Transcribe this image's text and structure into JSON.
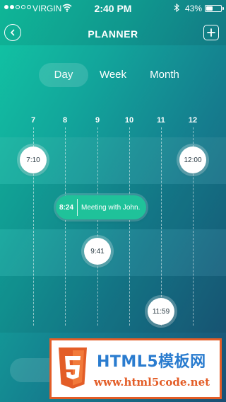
{
  "status": {
    "carrier": "VIRGIN",
    "time": "2:40 PM",
    "battery": "43%",
    "battery_level": 0.43
  },
  "nav": {
    "title": "PLANNER"
  },
  "tabs": [
    {
      "label": "Day",
      "selected": true
    },
    {
      "label": "Week",
      "selected": false
    },
    {
      "label": "Month",
      "selected": false
    }
  ],
  "timeline": {
    "hours": [
      "7",
      "8",
      "9",
      "10",
      "11",
      "12"
    ],
    "bubbles": [
      "7:10",
      "12:00",
      "9:41",
      "11:59"
    ],
    "event": {
      "time": "8:24",
      "title": "Meeting with John."
    }
  },
  "watermark": {
    "title": "HTML5模板网",
    "url": "www.html5code.net"
  },
  "colors": {
    "gradient_start": "#11c7a4",
    "gradient_end": "#1a4f74",
    "event_pill": "#1fc29a",
    "watermark_accent": "#e35d27",
    "watermark_title": "#2a7ccf"
  }
}
